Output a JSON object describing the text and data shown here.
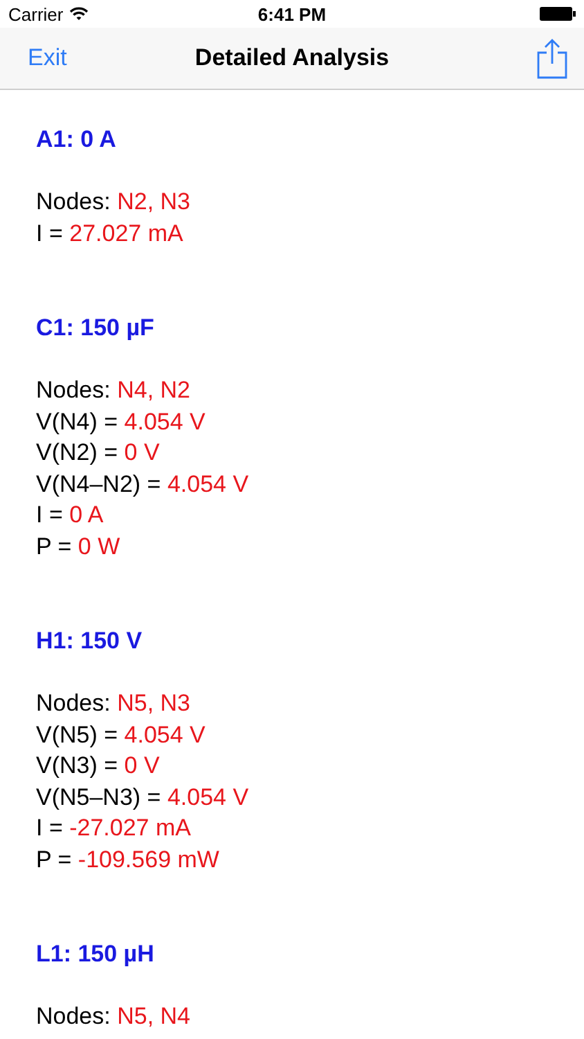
{
  "status_bar": {
    "carrier": "Carrier",
    "time": "6:41 PM"
  },
  "nav_bar": {
    "back": "Exit",
    "title": "Detailed Analysis"
  },
  "sections": [
    {
      "title": "A1: 0 A",
      "lines": [
        {
          "label": "Nodes: ",
          "value": "N2, N3"
        },
        {
          "label": "I = ",
          "value": "27.027 mA"
        }
      ]
    },
    {
      "title": "C1: 150 µF",
      "lines": [
        {
          "label": "Nodes: ",
          "value": "N4, N2"
        },
        {
          "label": "V(N4) = ",
          "value": "4.054 V"
        },
        {
          "label": "V(N2) = ",
          "value": "0 V"
        },
        {
          "label": "V(N4–N2) = ",
          "value": "4.054 V"
        },
        {
          "label": "I = ",
          "value": "0 A"
        },
        {
          "label": "P = ",
          "value": "0 W"
        }
      ]
    },
    {
      "title": "H1: 150 V",
      "lines": [
        {
          "label": "Nodes: ",
          "value": "N5, N3"
        },
        {
          "label": "V(N5) = ",
          "value": "4.054 V"
        },
        {
          "label": "V(N3) = ",
          "value": "0 V"
        },
        {
          "label": "V(N5–N3) = ",
          "value": "4.054 V"
        },
        {
          "label": "I = ",
          "value": "-27.027 mA"
        },
        {
          "label": "P = ",
          "value": "-109.569 mW"
        }
      ]
    },
    {
      "title": "L1: 150 µH",
      "lines": [
        {
          "label": "Nodes: ",
          "value": "N5, N4"
        }
      ]
    }
  ]
}
